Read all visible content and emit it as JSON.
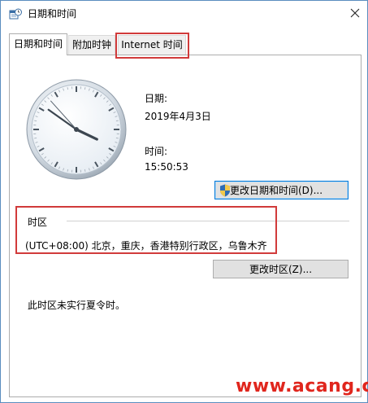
{
  "window": {
    "title": "日期和时间",
    "close_glyph": "✕"
  },
  "tabs": [
    {
      "label": "日期和时间",
      "active": true
    },
    {
      "label": "附加时钟",
      "active": false
    },
    {
      "label": "Internet 时间",
      "active": false
    }
  ],
  "datetime": {
    "date_label": "日期:",
    "date_value": "2019年4月3日",
    "time_label": "时间:",
    "time_value": "15:50:53",
    "change_button": "更改日期和时间(D)..."
  },
  "clock": {
    "hour": 15,
    "minute": 50,
    "second": 53
  },
  "timezone": {
    "group_label": "时区",
    "value": "(UTC+08:00) 北京，重庆，香港特别行政区，乌鲁木齐",
    "change_button": "更改时区(Z)..."
  },
  "dst_note": "此时区未实行夏令时。",
  "watermark": "www.acang.cn",
  "colors": {
    "highlight": "#d13b3b",
    "accent_border": "#0078d7",
    "watermark": "#e0261d"
  },
  "icons": {
    "title": "calendar-clock-icon",
    "close": "close-icon",
    "button": "uac-shield-icon"
  }
}
